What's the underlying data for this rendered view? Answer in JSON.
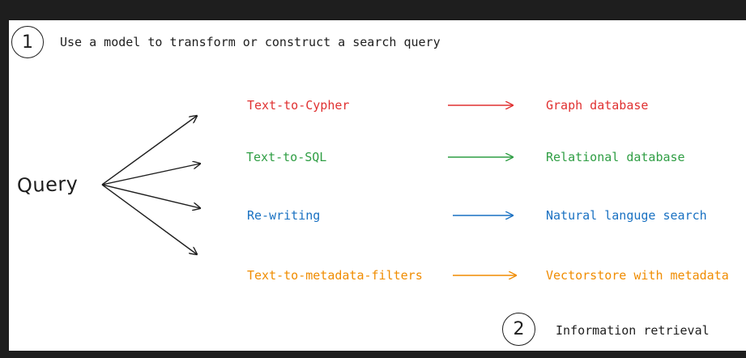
{
  "step1": {
    "number": "1",
    "text": "Use a model to transform or construct a search query"
  },
  "step2": {
    "number": "2",
    "text": "Information retrieval"
  },
  "query_label": "Query",
  "rows": [
    {
      "method": "Text-to-Cypher",
      "target": "Graph database",
      "color": "#e03131"
    },
    {
      "method": "Text-to-SQL",
      "target": "Relational database",
      "color": "#2f9e44"
    },
    {
      "method": "Re-writing",
      "target": "Natural languge search",
      "color": "#1971c2"
    },
    {
      "method": "Text-to-metadata-filters",
      "target": "Vectorstore with metadata",
      "color": "#f08c00"
    }
  ]
}
